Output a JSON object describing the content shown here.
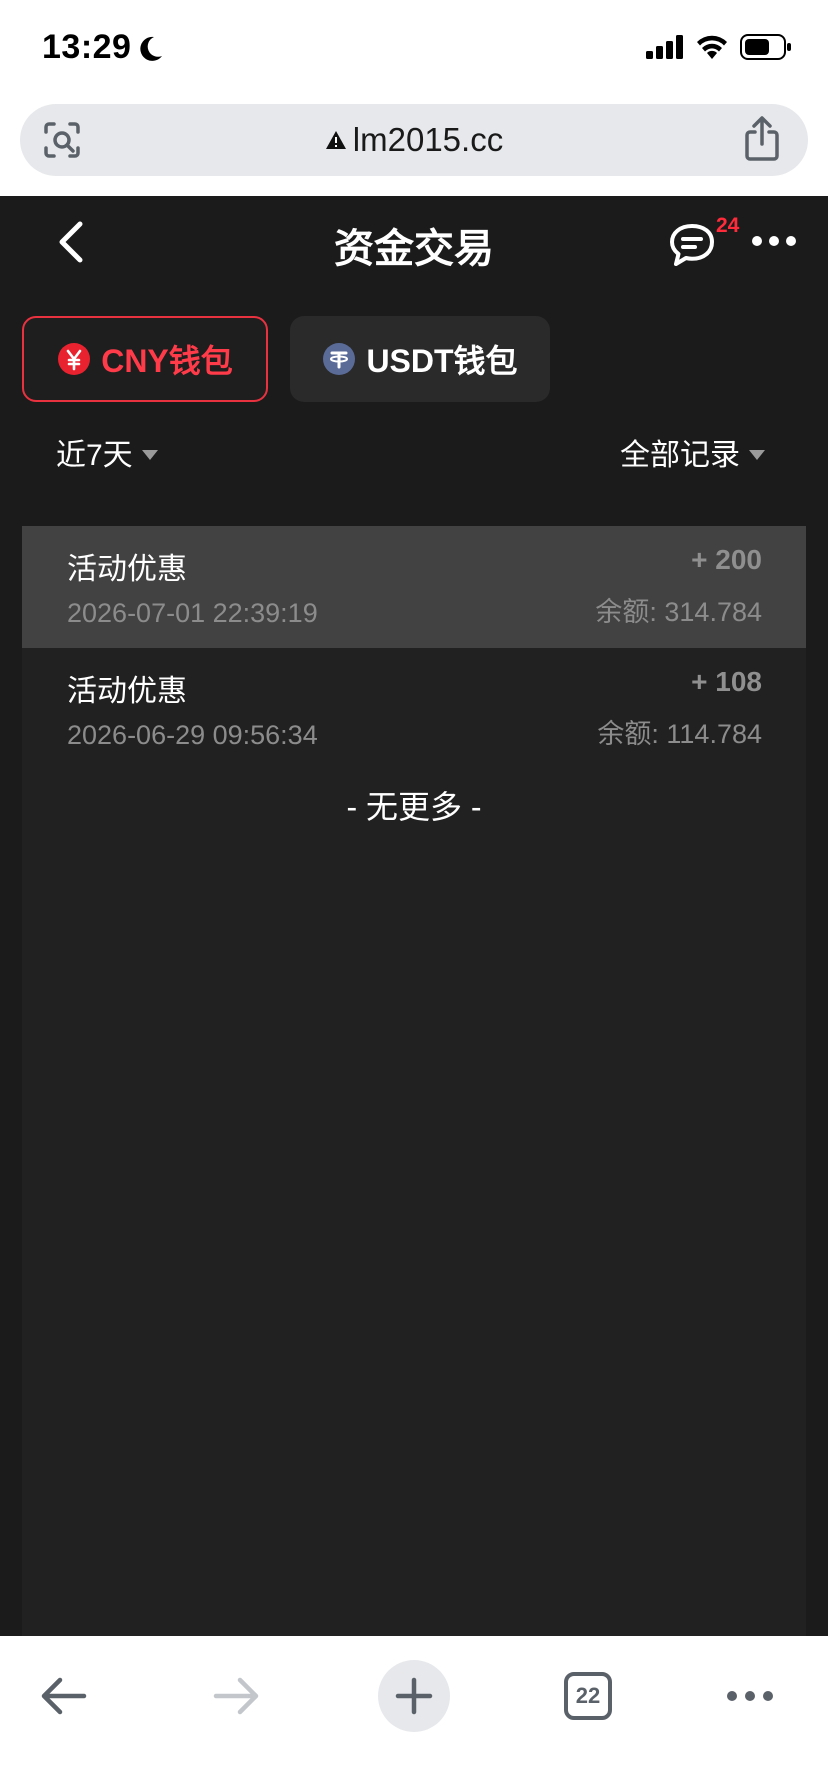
{
  "status_bar": {
    "time": "13:29"
  },
  "browser": {
    "url": "lm2015.cc"
  },
  "header": {
    "title": "资金交易",
    "message_badge": "24"
  },
  "wallet_tabs": [
    {
      "label": "CNY钱包",
      "selected": true,
      "icon": "yuan-icon",
      "color": "#ff3b4a"
    },
    {
      "label": "USDT钱包",
      "selected": false,
      "icon": "tether-icon",
      "color": "#ffffff"
    }
  ],
  "filters": {
    "period": "近7天",
    "record_type": "全部记录"
  },
  "records": [
    {
      "title": "活动优惠",
      "time": "2026-07-01 22:39:19",
      "amount": "+ 200",
      "balance": "余额: 314.784"
    },
    {
      "title": "活动优惠",
      "time": "2026-06-29 09:56:34",
      "amount": "+ 108",
      "balance": "余额: 114.784"
    }
  ],
  "no_more_text": "- 无更多 -",
  "bottom_toolbar": {
    "tab_count": "22"
  }
}
